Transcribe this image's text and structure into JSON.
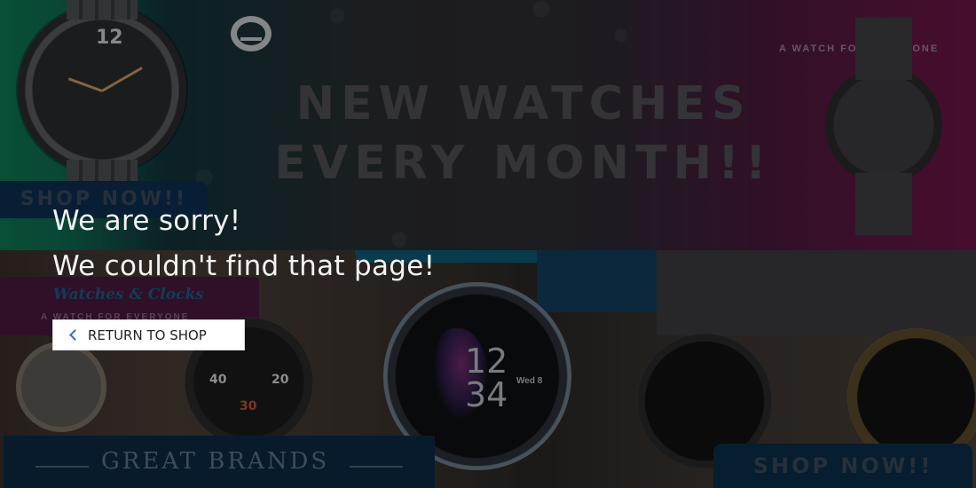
{
  "background": {
    "top_banner": {
      "headline_line1": "NEW WATCHES",
      "headline_line2": "EVERY MONTH!!",
      "tagline": "A WATCH FOR EVERYONE",
      "shop_now": "SHOP NOW!!",
      "watch_numeral": "12"
    },
    "promo_left": {
      "script_title": "Watches & Clocks",
      "subtitle": "A WATCH FOR EVERYONE"
    },
    "smartwatch": {
      "hour": "12",
      "minute": "34",
      "date": "Wed 8"
    },
    "field_watch_numerals": [
      "40",
      "30",
      "20"
    ],
    "great_brands": "GREAT BRANDS",
    "shop_now_bottom": "SHOP NOW!!"
  },
  "error": {
    "line1": "We are sorry!",
    "line2": "We couldn't find that page!"
  },
  "return_button": {
    "label": "RETURN TO SHOP",
    "icon": "chevron-left-icon"
  },
  "colors": {
    "overlay": "#000000",
    "message_text": "#f3f3f3",
    "button_bg": "#ffffff",
    "button_text": "#222222",
    "chevron": "#2a6fcf"
  }
}
